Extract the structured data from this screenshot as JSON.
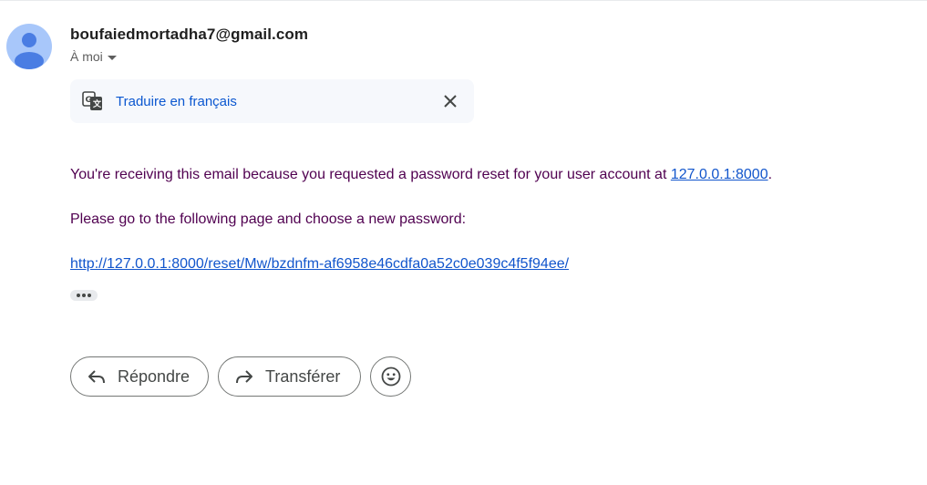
{
  "message": {
    "sender_email": "boufaiedmortadha7@gmail.com",
    "recipient_label": "À moi",
    "avatar_icon": "person-icon",
    "avatar_color": "#a8c7fa"
  },
  "translate_bar": {
    "icon": "translate-icon",
    "link_label": "Traduire en français",
    "close_icon": "close-icon"
  },
  "body": {
    "line1_text": "You're receiving this email because you requested a password reset for your user account at ",
    "line1_link": "127.0.0.1:8000",
    "line1_end": ".",
    "line2_text": "Please go to the following page and choose a new password:",
    "reset_link": "http://127.0.0.1:8000/reset/Mw/bzdnfm-af6958e46cdfa0a52c0e039c4f5f94ee/",
    "text_color": "#500050",
    "link_color": "#1155cc"
  },
  "actions": {
    "reply_label": "Répondre",
    "forward_label": "Transférer",
    "reply_icon": "reply-icon",
    "forward_icon": "forward-icon",
    "emoji_icon": "emoji-icon"
  }
}
